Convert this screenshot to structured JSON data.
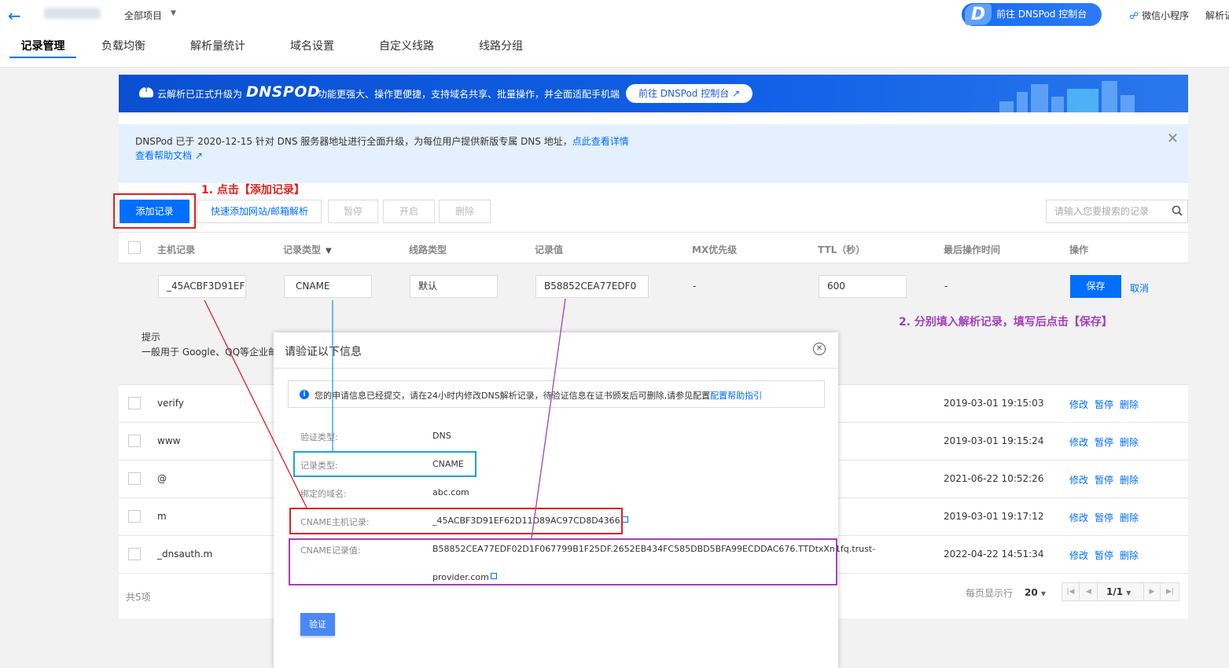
{
  "topbar": {
    "project_label": "全部项目",
    "dnspod_button": "前往 DNSPod 控制台",
    "mini_program": "微信小程序",
    "parse_cut": "解析记"
  },
  "tabs": [
    "记录管理",
    "负载均衡",
    "解析量统计",
    "域名设置",
    "自定义线路",
    "线路分组"
  ],
  "banner": {
    "text1": "云解析已正式升级为",
    "logo": "DNSPOD",
    "text2": "功能更强大、操作更便捷，支持域名共享、批量操作，并全面适配手机端",
    "button": "前往 DNSPod 控制台"
  },
  "notice": {
    "text": "DNSPod 已于 2020-12-15 针对 DNS 服务器地址进行全面升级，为每位用户提供新版专属 DNS 地址，",
    "link": "点此查看详情",
    "help": "查看帮助文档"
  },
  "annotations": {
    "step1": "1. 点击【添加记录】",
    "step2": "2. 分别填入解析记录，填写后点击【保存】"
  },
  "toolbar": {
    "add": "添加记录",
    "quick_add": "快速添加网站/邮箱解析",
    "pause": "暂停",
    "enable": "开启",
    "delete": "删除",
    "search_placeholder": "请输入您要搜索的记录"
  },
  "table": {
    "headers": {
      "host": "主机记录",
      "type": "记录类型",
      "line": "线路类型",
      "value": "记录值",
      "mx": "MX优先级",
      "ttl": "TTL（秒）",
      "last_op": "最后操作时间",
      "ops": "操作"
    },
    "edit_row": {
      "host": "_45ACBF3D91EF",
      "type": "CNAME",
      "line": "默认",
      "value": "B58852CEA77EDF0",
      "mx": "-",
      "ttl": "600",
      "last_op": "-",
      "save": "保存",
      "cancel": "取消"
    },
    "tip_title": "提示",
    "tip_text": "一般用于 Google、QQ等企业邮",
    "rows": [
      {
        "host": "verify",
        "time": "2019-03-01 19:15:03"
      },
      {
        "host": "www",
        "time": "2019-03-01 19:15:24"
      },
      {
        "host": "@",
        "time": "2021-06-22 10:52:26"
      },
      {
        "host": "m",
        "time": "2019-03-01 19:17:12"
      },
      {
        "host": "_dnsauth.m",
        "time": "2022-04-22 14:51:34"
      }
    ],
    "op_labels": {
      "edit": "修改",
      "pause": "暂停",
      "delete": "删除"
    }
  },
  "footer": {
    "total": "共5项",
    "per_page_label": "每页显示行",
    "per_page": "20",
    "page": "1/1"
  },
  "modal": {
    "title": "请验证以下信息",
    "info_text": "您的申请信息已经提交，请在24小时内修改DNS解析记录，待验证信息在证书颁发后可删除,请参见配置",
    "info_link": "配置帮助指引",
    "fields": [
      {
        "label": "验证类型:",
        "value": "DNS"
      },
      {
        "label": "记录类型:",
        "value": "CNAME"
      },
      {
        "label": "绑定的域名:",
        "value": "abc.com"
      },
      {
        "label": "CNAME主机记录:",
        "value": "_45ACBF3D91EF62D11D89AC97CD8D4366"
      },
      {
        "label": "CNAME记录值:",
        "value": "B58852CEA77EDF02D1F067799B1F25DF.2652EB434FC585DBD5BFA99ECDDAC676.TTDtxXn1fq.trust-",
        "value2": "provider.com"
      }
    ],
    "verify_button": "验证"
  },
  "colors": {
    "primary": "#006eff",
    "annotation_red": "#e02020",
    "annotation_purple": "#a23fbd",
    "annotation_blue": "#1ea0e0"
  }
}
